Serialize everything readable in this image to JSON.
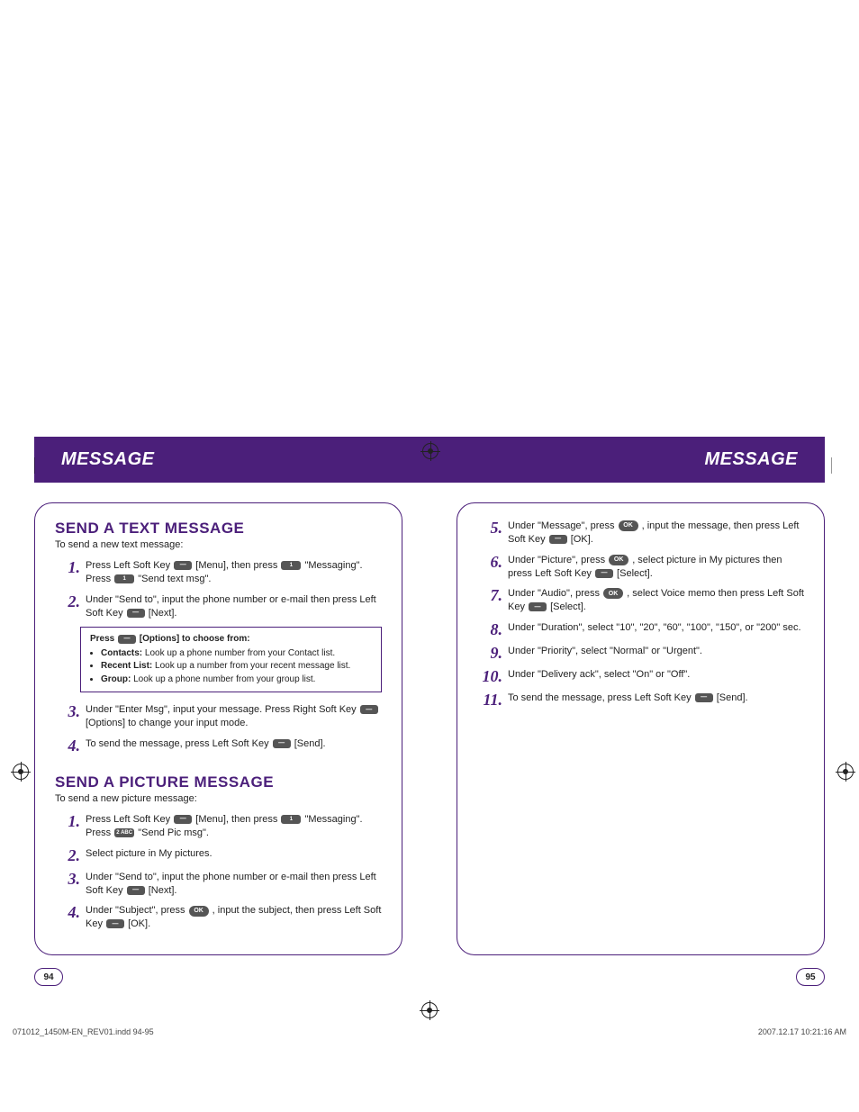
{
  "header": {
    "title_left": "MESSAGE",
    "title_right": "MESSAGE"
  },
  "left_page": {
    "section1": {
      "heading": "SEND A TEXT MESSAGE",
      "intro": "To send a new text message:",
      "steps": {
        "s1a": "Press Left Soft Key ",
        "s1b": " [Menu], then press ",
        "s1c": " \"Messaging\". Press ",
        "s1d": " \"Send text msg\".",
        "s2a": "Under \"Send to\", input the phone number or e-mail then press Left Soft Key ",
        "s2b": " [Next].",
        "s3a": "Under \"Enter Msg\", input your message. Press Right Soft Key ",
        "s3b": " [Options] to change your input mode.",
        "s4a": "To send the message, press Left Soft Key ",
        "s4b": "  [Send]."
      },
      "tip": {
        "lead_a": "Press ",
        "lead_b": " [Options] to choose from:",
        "bullets": [
          {
            "label": "Contacts:",
            "text": " Look up a phone number from your Contact list."
          },
          {
            "label": "Recent List:",
            "text": " Look up a number from your recent message list."
          },
          {
            "label": "Group:",
            "text": " Look up a phone number from your group list."
          }
        ]
      }
    },
    "section2": {
      "heading": "SEND A PICTURE MESSAGE",
      "intro": "To send a new picture message:",
      "steps": {
        "s1a": "Press Left Soft Key ",
        "s1b": " [Menu], then press ",
        "s1c": " \"Messaging\". Press ",
        "s1d": " \"Send Pic msg\".",
        "s2": "Select picture in My pictures.",
        "s3a": "Under \"Send to\", input the phone number or e-mail then press Left Soft Key ",
        "s3b": " [Next].",
        "s4a": "Under \"Subject\", press ",
        "s4b": " , input the subject, then press Left Soft Key ",
        "s4c": " [OK]."
      }
    },
    "page_number": "94"
  },
  "right_page": {
    "steps": {
      "s5a": "Under \"Message\", press ",
      "s5b": " , input the message, then press Left Soft Key ",
      "s5c": " [OK].",
      "s6a": "Under \"Picture\", press ",
      "s6b": " , select picture in My pictures then press Left Soft Key ",
      "s6c": " [Select].",
      "s7a": "Under \"Audio\", press ",
      "s7b": " , select Voice memo then press Left Soft Key ",
      "s7c": " [Select].",
      "s8": "Under \"Duration\", select \"10\", \"20\", \"60\", \"100\", \"150\", or \"200\" sec.",
      "s9": "Under \"Priority\", select \"Normal\" or \"Urgent\".",
      "s10": "Under \"Delivery ack\", select \"On\" or \"Off\".",
      "s11a": "To send the message, press Left Soft Key ",
      "s11b": " [Send]."
    },
    "page_number": "95"
  },
  "footer": {
    "left": "071012_1450M-EN_REV01.indd   94-95",
    "right": "2007.12.17   10:21:16 AM"
  },
  "keys": {
    "soft": "—",
    "one": "1",
    "two": "2 ABC",
    "ok": "OK"
  }
}
